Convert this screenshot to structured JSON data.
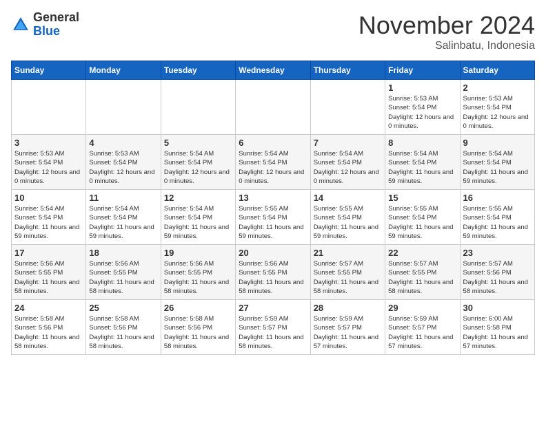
{
  "header": {
    "logo_general": "General",
    "logo_blue": "Blue",
    "month_title": "November 2024",
    "subtitle": "Salinbatu, Indonesia"
  },
  "days_of_week": [
    "Sunday",
    "Monday",
    "Tuesday",
    "Wednesday",
    "Thursday",
    "Friday",
    "Saturday"
  ],
  "weeks": [
    [
      {
        "day": "",
        "info": ""
      },
      {
        "day": "",
        "info": ""
      },
      {
        "day": "",
        "info": ""
      },
      {
        "day": "",
        "info": ""
      },
      {
        "day": "",
        "info": ""
      },
      {
        "day": "1",
        "info": "Sunrise: 5:53 AM\nSunset: 5:54 PM\nDaylight: 12 hours and 0 minutes."
      },
      {
        "day": "2",
        "info": "Sunrise: 5:53 AM\nSunset: 5:54 PM\nDaylight: 12 hours and 0 minutes."
      }
    ],
    [
      {
        "day": "3",
        "info": "Sunrise: 5:53 AM\nSunset: 5:54 PM\nDaylight: 12 hours and 0 minutes."
      },
      {
        "day": "4",
        "info": "Sunrise: 5:53 AM\nSunset: 5:54 PM\nDaylight: 12 hours and 0 minutes."
      },
      {
        "day": "5",
        "info": "Sunrise: 5:54 AM\nSunset: 5:54 PM\nDaylight: 12 hours and 0 minutes."
      },
      {
        "day": "6",
        "info": "Sunrise: 5:54 AM\nSunset: 5:54 PM\nDaylight: 12 hours and 0 minutes."
      },
      {
        "day": "7",
        "info": "Sunrise: 5:54 AM\nSunset: 5:54 PM\nDaylight: 12 hours and 0 minutes."
      },
      {
        "day": "8",
        "info": "Sunrise: 5:54 AM\nSunset: 5:54 PM\nDaylight: 11 hours and 59 minutes."
      },
      {
        "day": "9",
        "info": "Sunrise: 5:54 AM\nSunset: 5:54 PM\nDaylight: 11 hours and 59 minutes."
      }
    ],
    [
      {
        "day": "10",
        "info": "Sunrise: 5:54 AM\nSunset: 5:54 PM\nDaylight: 11 hours and 59 minutes."
      },
      {
        "day": "11",
        "info": "Sunrise: 5:54 AM\nSunset: 5:54 PM\nDaylight: 11 hours and 59 minutes."
      },
      {
        "day": "12",
        "info": "Sunrise: 5:54 AM\nSunset: 5:54 PM\nDaylight: 11 hours and 59 minutes."
      },
      {
        "day": "13",
        "info": "Sunrise: 5:55 AM\nSunset: 5:54 PM\nDaylight: 11 hours and 59 minutes."
      },
      {
        "day": "14",
        "info": "Sunrise: 5:55 AM\nSunset: 5:54 PM\nDaylight: 11 hours and 59 minutes."
      },
      {
        "day": "15",
        "info": "Sunrise: 5:55 AM\nSunset: 5:54 PM\nDaylight: 11 hours and 59 minutes."
      },
      {
        "day": "16",
        "info": "Sunrise: 5:55 AM\nSunset: 5:54 PM\nDaylight: 11 hours and 59 minutes."
      }
    ],
    [
      {
        "day": "17",
        "info": "Sunrise: 5:56 AM\nSunset: 5:55 PM\nDaylight: 11 hours and 58 minutes."
      },
      {
        "day": "18",
        "info": "Sunrise: 5:56 AM\nSunset: 5:55 PM\nDaylight: 11 hours and 58 minutes."
      },
      {
        "day": "19",
        "info": "Sunrise: 5:56 AM\nSunset: 5:55 PM\nDaylight: 11 hours and 58 minutes."
      },
      {
        "day": "20",
        "info": "Sunrise: 5:56 AM\nSunset: 5:55 PM\nDaylight: 11 hours and 58 minutes."
      },
      {
        "day": "21",
        "info": "Sunrise: 5:57 AM\nSunset: 5:55 PM\nDaylight: 11 hours and 58 minutes."
      },
      {
        "day": "22",
        "info": "Sunrise: 5:57 AM\nSunset: 5:55 PM\nDaylight: 11 hours and 58 minutes."
      },
      {
        "day": "23",
        "info": "Sunrise: 5:57 AM\nSunset: 5:56 PM\nDaylight: 11 hours and 58 minutes."
      }
    ],
    [
      {
        "day": "24",
        "info": "Sunrise: 5:58 AM\nSunset: 5:56 PM\nDaylight: 11 hours and 58 minutes."
      },
      {
        "day": "25",
        "info": "Sunrise: 5:58 AM\nSunset: 5:56 PM\nDaylight: 11 hours and 58 minutes."
      },
      {
        "day": "26",
        "info": "Sunrise: 5:58 AM\nSunset: 5:56 PM\nDaylight: 11 hours and 58 minutes."
      },
      {
        "day": "27",
        "info": "Sunrise: 5:59 AM\nSunset: 5:57 PM\nDaylight: 11 hours and 58 minutes."
      },
      {
        "day": "28",
        "info": "Sunrise: 5:59 AM\nSunset: 5:57 PM\nDaylight: 11 hours and 57 minutes."
      },
      {
        "day": "29",
        "info": "Sunrise: 5:59 AM\nSunset: 5:57 PM\nDaylight: 11 hours and 57 minutes."
      },
      {
        "day": "30",
        "info": "Sunrise: 6:00 AM\nSunset: 5:58 PM\nDaylight: 11 hours and 57 minutes."
      }
    ]
  ]
}
